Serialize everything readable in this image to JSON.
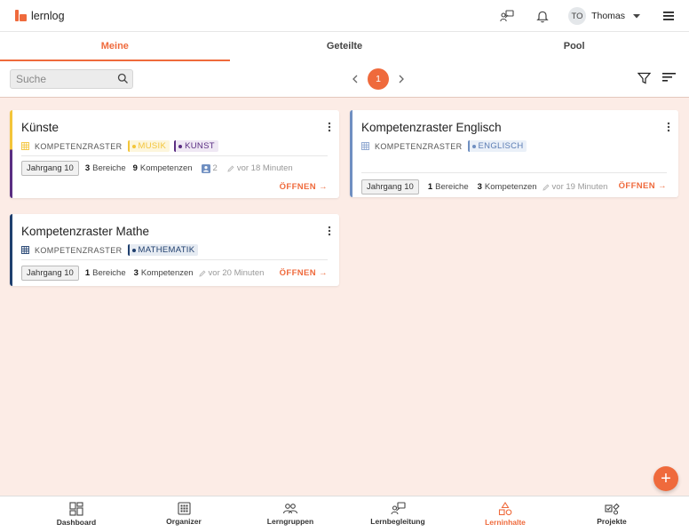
{
  "app": {
    "name": "lernlog",
    "brand_color": "#ef6a3c"
  },
  "user": {
    "initials": "TO",
    "name": "Thomas"
  },
  "tabs": [
    {
      "label": "Meine",
      "active": true
    },
    {
      "label": "Geteilte",
      "active": false
    },
    {
      "label": "Pool",
      "active": false
    }
  ],
  "search": {
    "placeholder": "Suche",
    "value": ""
  },
  "pagination": {
    "current_page": "1"
  },
  "cards": [
    {
      "title": "Künste",
      "type_label": "KOMPETENZRASTER",
      "strip_color": "#5a2e82",
      "tags": [
        {
          "label": "MUSIK",
          "color": "#f3c53a"
        },
        {
          "label": "KUNST",
          "color": "#5a2e82"
        }
      ],
      "grade": "Jahrgang 10",
      "areas_count": "3",
      "areas_label": "Bereiche",
      "competencies_count": "9",
      "competencies_label": "Kompetenzen",
      "shared_count": "2",
      "edited": "vor 18 Minuten",
      "open_label": "ÖFFNEN →"
    },
    {
      "title": "Kompetenzraster Englisch",
      "type_label": "KOMPETENZRASTER",
      "strip_color": "#6f8fc1",
      "tags": [
        {
          "label": "ENGLISCH",
          "color": "#6f8fc1"
        }
      ],
      "grade": "Jahrgang 10",
      "areas_count": "1",
      "areas_label": "Bereiche",
      "competencies_count": "3",
      "competencies_label": "Kompetenzen",
      "edited": "vor 19 Minuten",
      "open_label": "ÖFFNEN →"
    },
    {
      "title": "Kompetenzraster Mathe",
      "type_label": "KOMPETENZRASTER",
      "strip_color": "#1f3f6e",
      "tags": [
        {
          "label": "MATHEMATIK",
          "color": "#1f3f6e"
        }
      ],
      "grade": "Jahrgang 10",
      "areas_count": "1",
      "areas_label": "Bereiche",
      "competencies_count": "3",
      "competencies_label": "Kompetenzen",
      "edited": "vor 20 Minuten",
      "open_label": "ÖFFNEN →"
    }
  ],
  "fab": {
    "label": "+"
  },
  "bottom_nav": [
    {
      "label": "Dashboard",
      "icon": "dashboard-icon",
      "active": false
    },
    {
      "label": "Organizer",
      "icon": "calendar-grid-icon",
      "active": false
    },
    {
      "label": "Lerngruppen",
      "icon": "groups-icon",
      "active": false
    },
    {
      "label": "Lernbegleitung",
      "icon": "mentoring-icon",
      "active": false
    },
    {
      "label": "Lerninhalte",
      "icon": "shapes-icon",
      "active": true
    },
    {
      "label": "Projekte",
      "icon": "project-icon",
      "active": false
    }
  ]
}
